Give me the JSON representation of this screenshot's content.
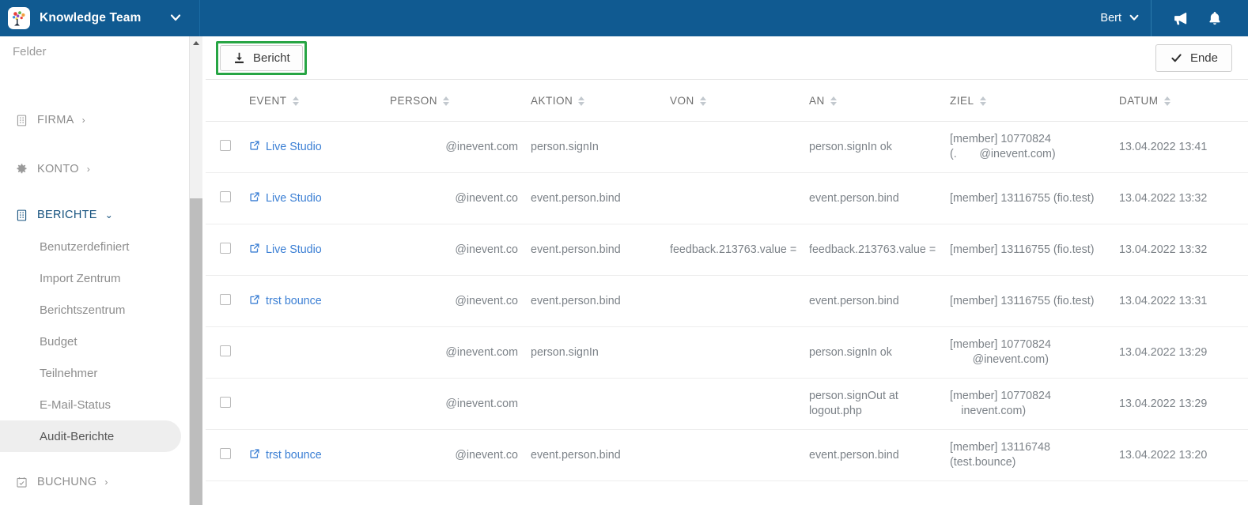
{
  "topbar": {
    "logo_icon": "brain-network-logo",
    "workspace": "Knowledge Team",
    "workspace_chevron": "⌄",
    "user": "Bert",
    "user_chevron": "⌄",
    "megaphone_icon": "megaphone-icon",
    "bell_icon": "bell-icon",
    "background_color": "#105a91"
  },
  "sidebar": {
    "partial_top_item": "Felder",
    "groups": [
      {
        "label": "FIRMA",
        "icon": "building-icon",
        "arrow": "›",
        "open": false
      },
      {
        "label": "KONTO",
        "icon": "gear-icon",
        "arrow": "›",
        "open": false
      },
      {
        "label": "BERICHTE",
        "icon": "building-icon",
        "arrow": "⌄",
        "open": true
      }
    ],
    "berichte_items": [
      {
        "label": "Benutzerdefiniert",
        "active": false
      },
      {
        "label": "Import Zentrum",
        "active": false
      },
      {
        "label": "Berichtszentrum",
        "active": false
      },
      {
        "label": "Budget",
        "active": false
      },
      {
        "label": "Teilnehmer",
        "active": false
      },
      {
        "label": "E-Mail-Status",
        "active": false
      },
      {
        "label": "Audit-Berichte",
        "active": true
      }
    ],
    "bottom_group": {
      "label": "BUCHUNG",
      "icon": "calendar-check-icon",
      "arrow": "›"
    }
  },
  "toolbar": {
    "report_button": {
      "label": "Bericht",
      "icon": "download-icon",
      "highlight_color": "#27a544"
    },
    "end_button": {
      "label": "Ende",
      "icon": "check-icon"
    }
  },
  "table": {
    "columns": [
      {
        "key": "checkbox",
        "label": ""
      },
      {
        "key": "event",
        "label": "EVENT"
      },
      {
        "key": "person",
        "label": "PERSON"
      },
      {
        "key": "aktion",
        "label": "AKTION"
      },
      {
        "key": "von",
        "label": "VON"
      },
      {
        "key": "an",
        "label": "AN"
      },
      {
        "key": "ziel",
        "label": "ZIEL"
      },
      {
        "key": "datum",
        "label": "DATUM"
      }
    ],
    "rows": [
      {
        "event": "Live Studio",
        "event_link": true,
        "person": "@inevent.com",
        "aktion": "person.signIn",
        "von": "",
        "an": "person.signIn ok",
        "ziel_1": "[member] 10770824",
        "ziel_2": "(.  @inevent.com)",
        "datum": "13.04.2022 13:41"
      },
      {
        "event": "Live Studio",
        "event_link": true,
        "person": "@inevent.co",
        "aktion": "event.person.bind",
        "von": "",
        "an": "event.person.bind",
        "ziel_1": "[member] 13116755 (fio.test)",
        "ziel_2": "",
        "datum": "13.04.2022 13:32"
      },
      {
        "event": "Live Studio",
        "event_link": true,
        "person": "@inevent.co",
        "aktion": "event.person.bind",
        "von": "feedback.213763.value =",
        "an": "feedback.213763.value =",
        "ziel_1": "[member] 13116755 (fio.test)",
        "ziel_2": "",
        "datum": "13.04.2022 13:32"
      },
      {
        "event": "trst bounce",
        "event_link": true,
        "person": "@inevent.co",
        "aktion": "event.person.bind",
        "von": "",
        "an": "event.person.bind",
        "ziel_1": "[member] 13116755 (fio.test)",
        "ziel_2": "",
        "datum": "13.04.2022 13:31"
      },
      {
        "event": "",
        "event_link": false,
        "person": "@inevent.com",
        "aktion": "person.signIn",
        "von": "",
        "an": "person.signIn ok",
        "ziel_1": "[member] 10770824",
        "ziel_2": "  @inevent.com)",
        "datum": "13.04.2022 13:29"
      },
      {
        "event": "",
        "event_link": false,
        "person": "@inevent.com",
        "aktion": "",
        "von": "",
        "an": "person.signOut at logout.php",
        "ziel_1": "[member] 10770824",
        "ziel_2": " inevent.com)",
        "datum": "13.04.2022 13:29"
      },
      {
        "event": "trst bounce",
        "event_link": true,
        "person": "@inevent.co",
        "aktion": "event.person.bind",
        "von": "",
        "an": "event.person.bind",
        "ziel_1": "[member] 13116748 (test.bounce)",
        "ziel_2": "",
        "datum": "13.04.2022 13:20"
      }
    ]
  }
}
